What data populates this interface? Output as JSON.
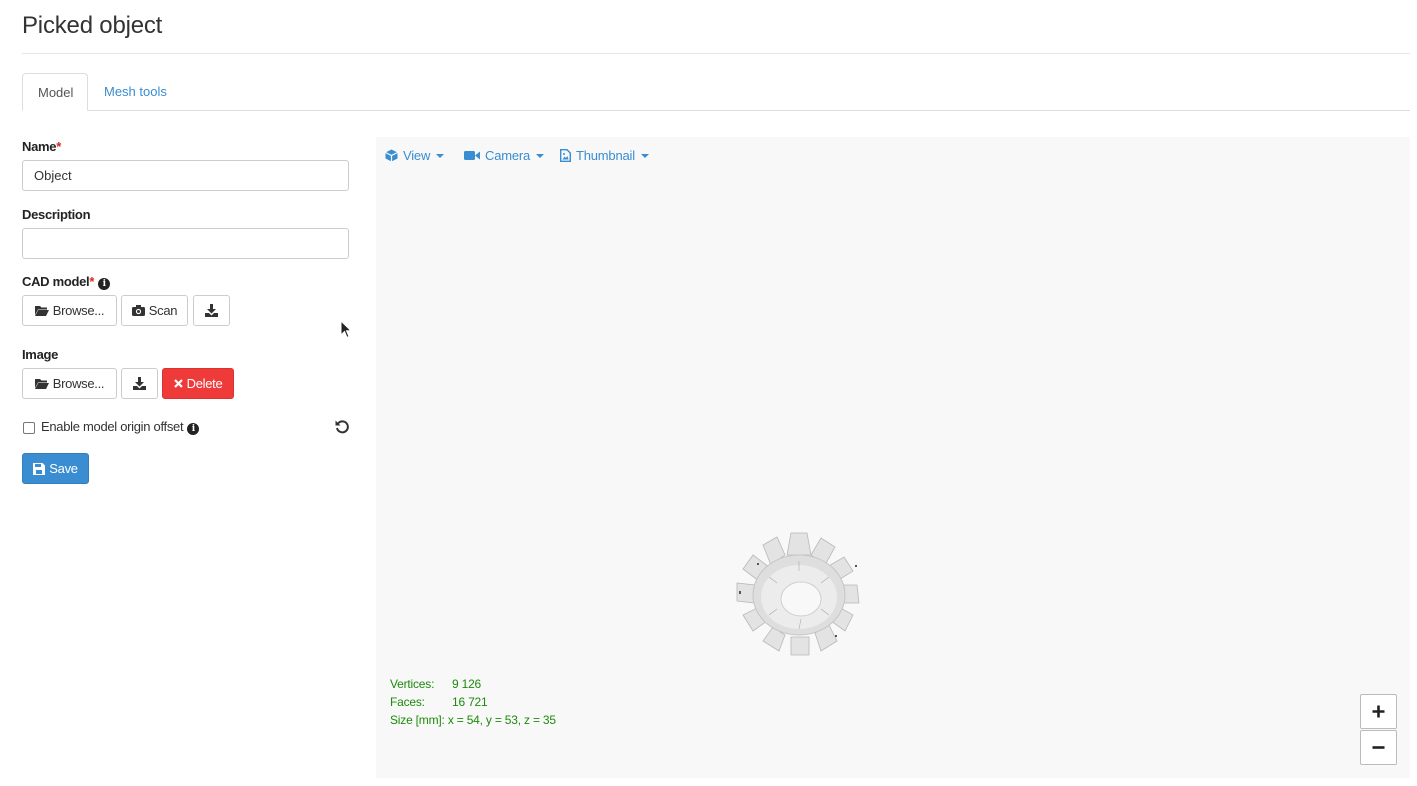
{
  "page": {
    "title": "Picked object"
  },
  "tabs": [
    {
      "label": "Model",
      "active": true
    },
    {
      "label": "Mesh tools",
      "active": false
    }
  ],
  "form": {
    "name": {
      "label": "Name",
      "required_mark": "*",
      "value": "Object"
    },
    "description": {
      "label": "Description",
      "value": ""
    },
    "cad_model": {
      "label": "CAD model",
      "required_mark": "*",
      "info_icon": "info-circle-icon",
      "browse_label": "Browse...",
      "scan_label": "Scan",
      "download_icon": "download-icon"
    },
    "image": {
      "label": "Image",
      "browse_label": "Browse...",
      "download_icon": "download-icon",
      "delete_label": "Delete"
    },
    "origin_offset": {
      "label": "Enable model origin offset",
      "checked": false,
      "info_icon": "info-circle-icon",
      "reset_icon": "undo-icon"
    },
    "save_label": "Save"
  },
  "viewer": {
    "menu": [
      {
        "label": "View",
        "icon": "cube-icon"
      },
      {
        "label": "Camera",
        "icon": "video-camera-icon"
      },
      {
        "label": "Thumbnail",
        "icon": "image-file-icon"
      }
    ],
    "stats": {
      "vertices_label": "Vertices:",
      "vertices_value": "9 126",
      "faces_label": "Faces:",
      "faces_value": "16 721",
      "size_label": "Size [mm]:",
      "size_value": "x = 54, y = 53, z = 35"
    },
    "zoom_in_icon": "plus-icon",
    "zoom_out_icon": "minus-icon"
  },
  "colors": {
    "link": "#3a8dd0",
    "danger": "#ef3a3a",
    "stats": "#1d8a0c",
    "viewer_bg": "#f8f8f8"
  }
}
